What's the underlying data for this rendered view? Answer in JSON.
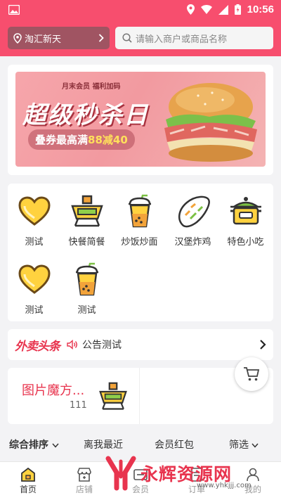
{
  "status_bar": {
    "time": "10:56"
  },
  "header": {
    "location": "淘汇新天",
    "search_placeholder": "请输入商户或商品名称"
  },
  "banner": {
    "tag": "月末会员 福利加码",
    "headline": "超级秒杀日",
    "promo_prefix": "叠券最高满",
    "promo_amount": "88减40"
  },
  "categories": [
    {
      "label": "测试",
      "icon": "heart-icon"
    },
    {
      "label": "快餐简餐",
      "icon": "hotpot-icon"
    },
    {
      "label": "炒饭炒面",
      "icon": "drink-cup-icon"
    },
    {
      "label": "汉堡炸鸡",
      "icon": "bread-icon"
    },
    {
      "label": "特色小吃",
      "icon": "pot-icon"
    },
    {
      "label": "测试",
      "icon": "heart-icon"
    },
    {
      "label": "测试",
      "icon": "drink-cup-icon"
    }
  ],
  "notice": {
    "brand": "外卖头条",
    "text": "公告测试"
  },
  "magic": {
    "title": "图片魔方...",
    "count": "111"
  },
  "sort": {
    "composite": "综合排序",
    "nearest": "离我最近",
    "member": "会员红包",
    "filter": "筛选"
  },
  "tabs": [
    {
      "label": "首页",
      "icon": "home-icon",
      "active": true
    },
    {
      "label": "店铺",
      "icon": "store-icon",
      "active": false
    },
    {
      "label": "会员",
      "icon": "member-icon",
      "active": false
    },
    {
      "label": "订单",
      "icon": "order-icon",
      "active": false
    },
    {
      "label": "我的",
      "icon": "user-icon",
      "active": false
    }
  ],
  "watermark": {
    "text": "永辉资源网",
    "url": "www.yhkjjj.com"
  },
  "colors": {
    "brand": "#f74e6e",
    "accent_red": "#e8344e",
    "icon_yellow": "#ffd23f"
  }
}
